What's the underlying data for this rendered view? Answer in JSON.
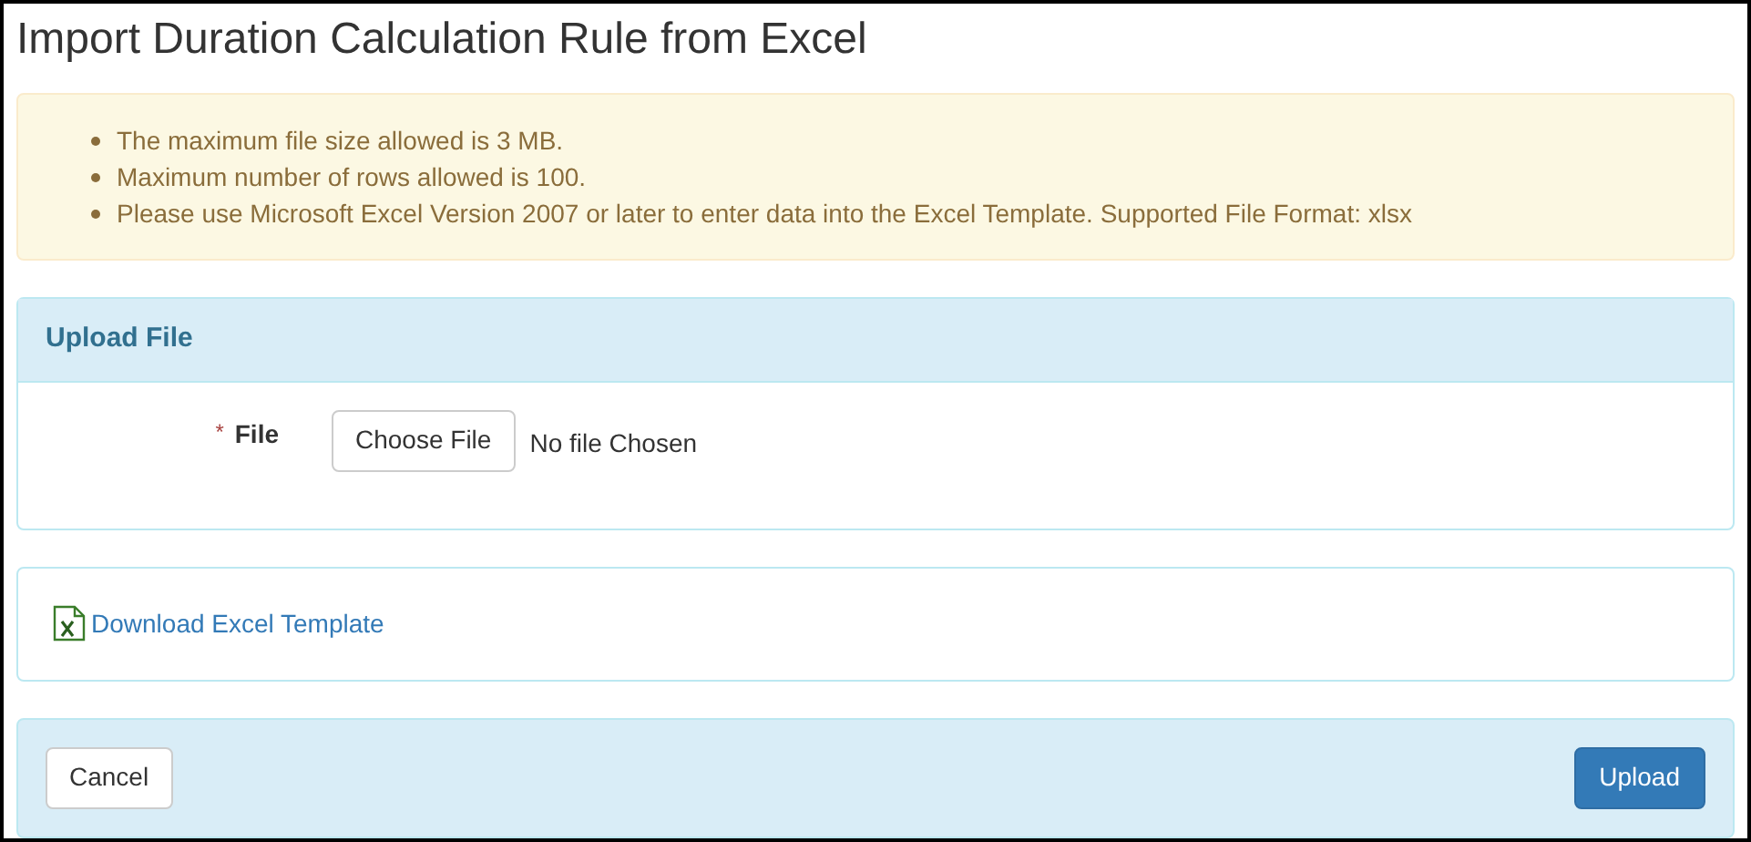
{
  "title": "Import Duration Calculation Rule from Excel",
  "notes": [
    "The maximum file size allowed is 3 MB.",
    "Maximum number of rows allowed is 100.",
    "Please use Microsoft Excel Version 2007 or later to enter data into the Excel Template. Supported File Format: xlsx"
  ],
  "upload_panel": {
    "heading": "Upload File",
    "field": {
      "required_mark": "*",
      "label": "File",
      "button": "Choose File",
      "status": "No file Chosen"
    }
  },
  "template_link": "Download Excel Template",
  "footer": {
    "cancel": "Cancel",
    "upload": "Upload"
  }
}
